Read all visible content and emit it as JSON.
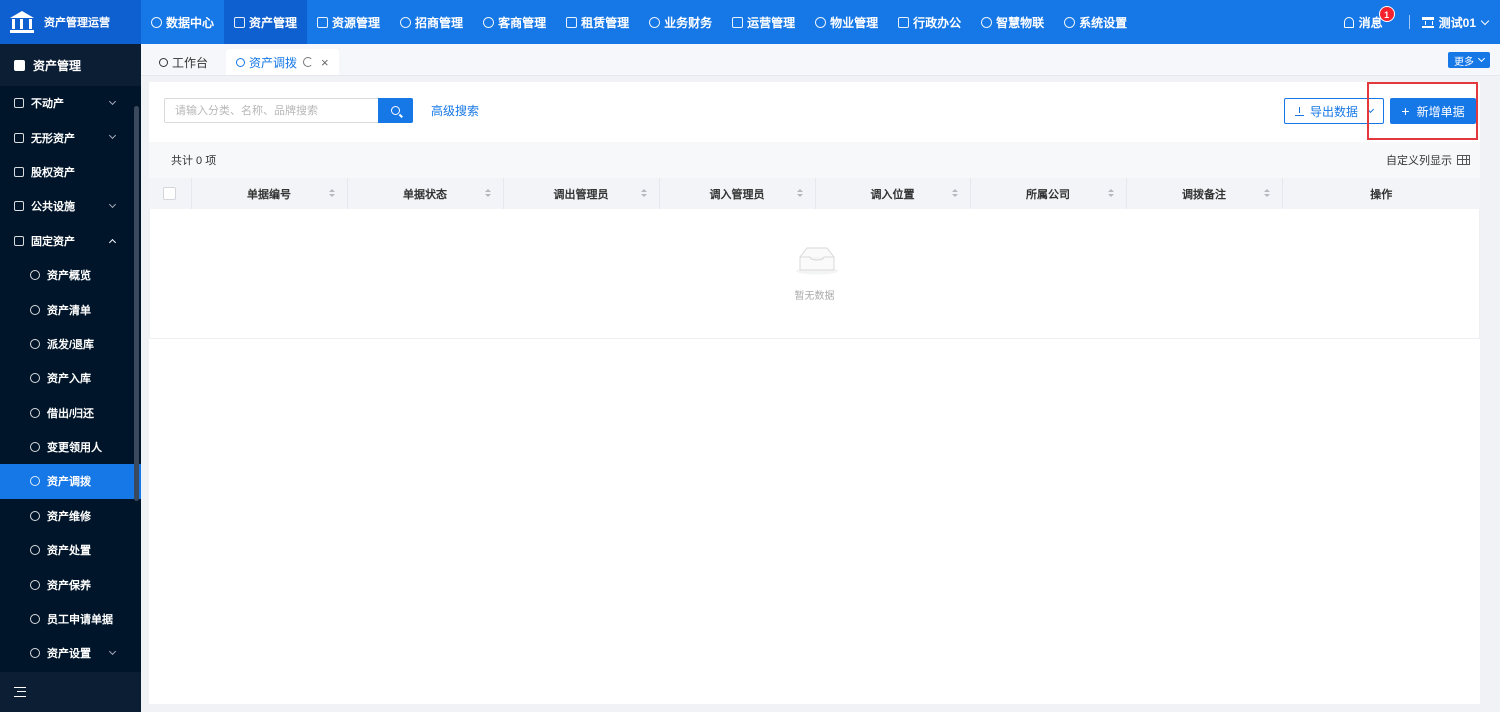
{
  "app": {
    "title": "资产管理运营"
  },
  "topnav": {
    "items": [
      {
        "label": "数据中心",
        "active": false
      },
      {
        "label": "资产管理",
        "active": true
      },
      {
        "label": "资源管理",
        "active": false
      },
      {
        "label": "招商管理",
        "active": false
      },
      {
        "label": "客商管理",
        "active": false
      },
      {
        "label": "租赁管理",
        "active": false
      },
      {
        "label": "业务财务",
        "active": false
      },
      {
        "label": "运营管理",
        "active": false
      },
      {
        "label": "物业管理",
        "active": false
      },
      {
        "label": "行政办公",
        "active": false
      },
      {
        "label": "智慧物联",
        "active": false
      },
      {
        "label": "系统设置",
        "active": false
      }
    ],
    "messages_label": "消息",
    "messages_badge": "1",
    "user_name": "测试01"
  },
  "sidebar": {
    "title": "资产管理",
    "items": [
      {
        "label": "不动产"
      },
      {
        "label": "无形资产"
      },
      {
        "label": "股权资产"
      },
      {
        "label": "公共设施"
      },
      {
        "label": "固定资产"
      },
      {
        "label": "资产概览"
      },
      {
        "label": "资产清单"
      },
      {
        "label": "派发/退库"
      },
      {
        "label": "资产入库"
      },
      {
        "label": "借出/归还"
      },
      {
        "label": "变更领用人"
      },
      {
        "label": "资产调拨"
      },
      {
        "label": "资产维修"
      },
      {
        "label": "资产处置"
      },
      {
        "label": "资产保养"
      },
      {
        "label": "员工申请单据"
      },
      {
        "label": "资产设置"
      }
    ]
  },
  "tabs": {
    "items": [
      {
        "label": "工作台"
      },
      {
        "label": "资产调拨"
      }
    ],
    "more_label": "更多"
  },
  "toolbar": {
    "search_placeholder": "请输入分类、名称、品牌搜索",
    "search_value": "",
    "advanced_search": "高级搜索",
    "export_label": "导出数据",
    "add_label": "新增单据"
  },
  "summary": {
    "count_text": "共计 0 项",
    "custom_columns": "自定义列显示"
  },
  "table": {
    "columns": [
      "单据编号",
      "单据状态",
      "调出管理员",
      "调入管理员",
      "调入位置",
      "所属公司",
      "调拨备注",
      "操作"
    ],
    "empty_text": "暂无数据"
  },
  "colors": {
    "primary": "#1677e6",
    "sidebar_bg": "#001529",
    "highlight": "#e4393c"
  }
}
